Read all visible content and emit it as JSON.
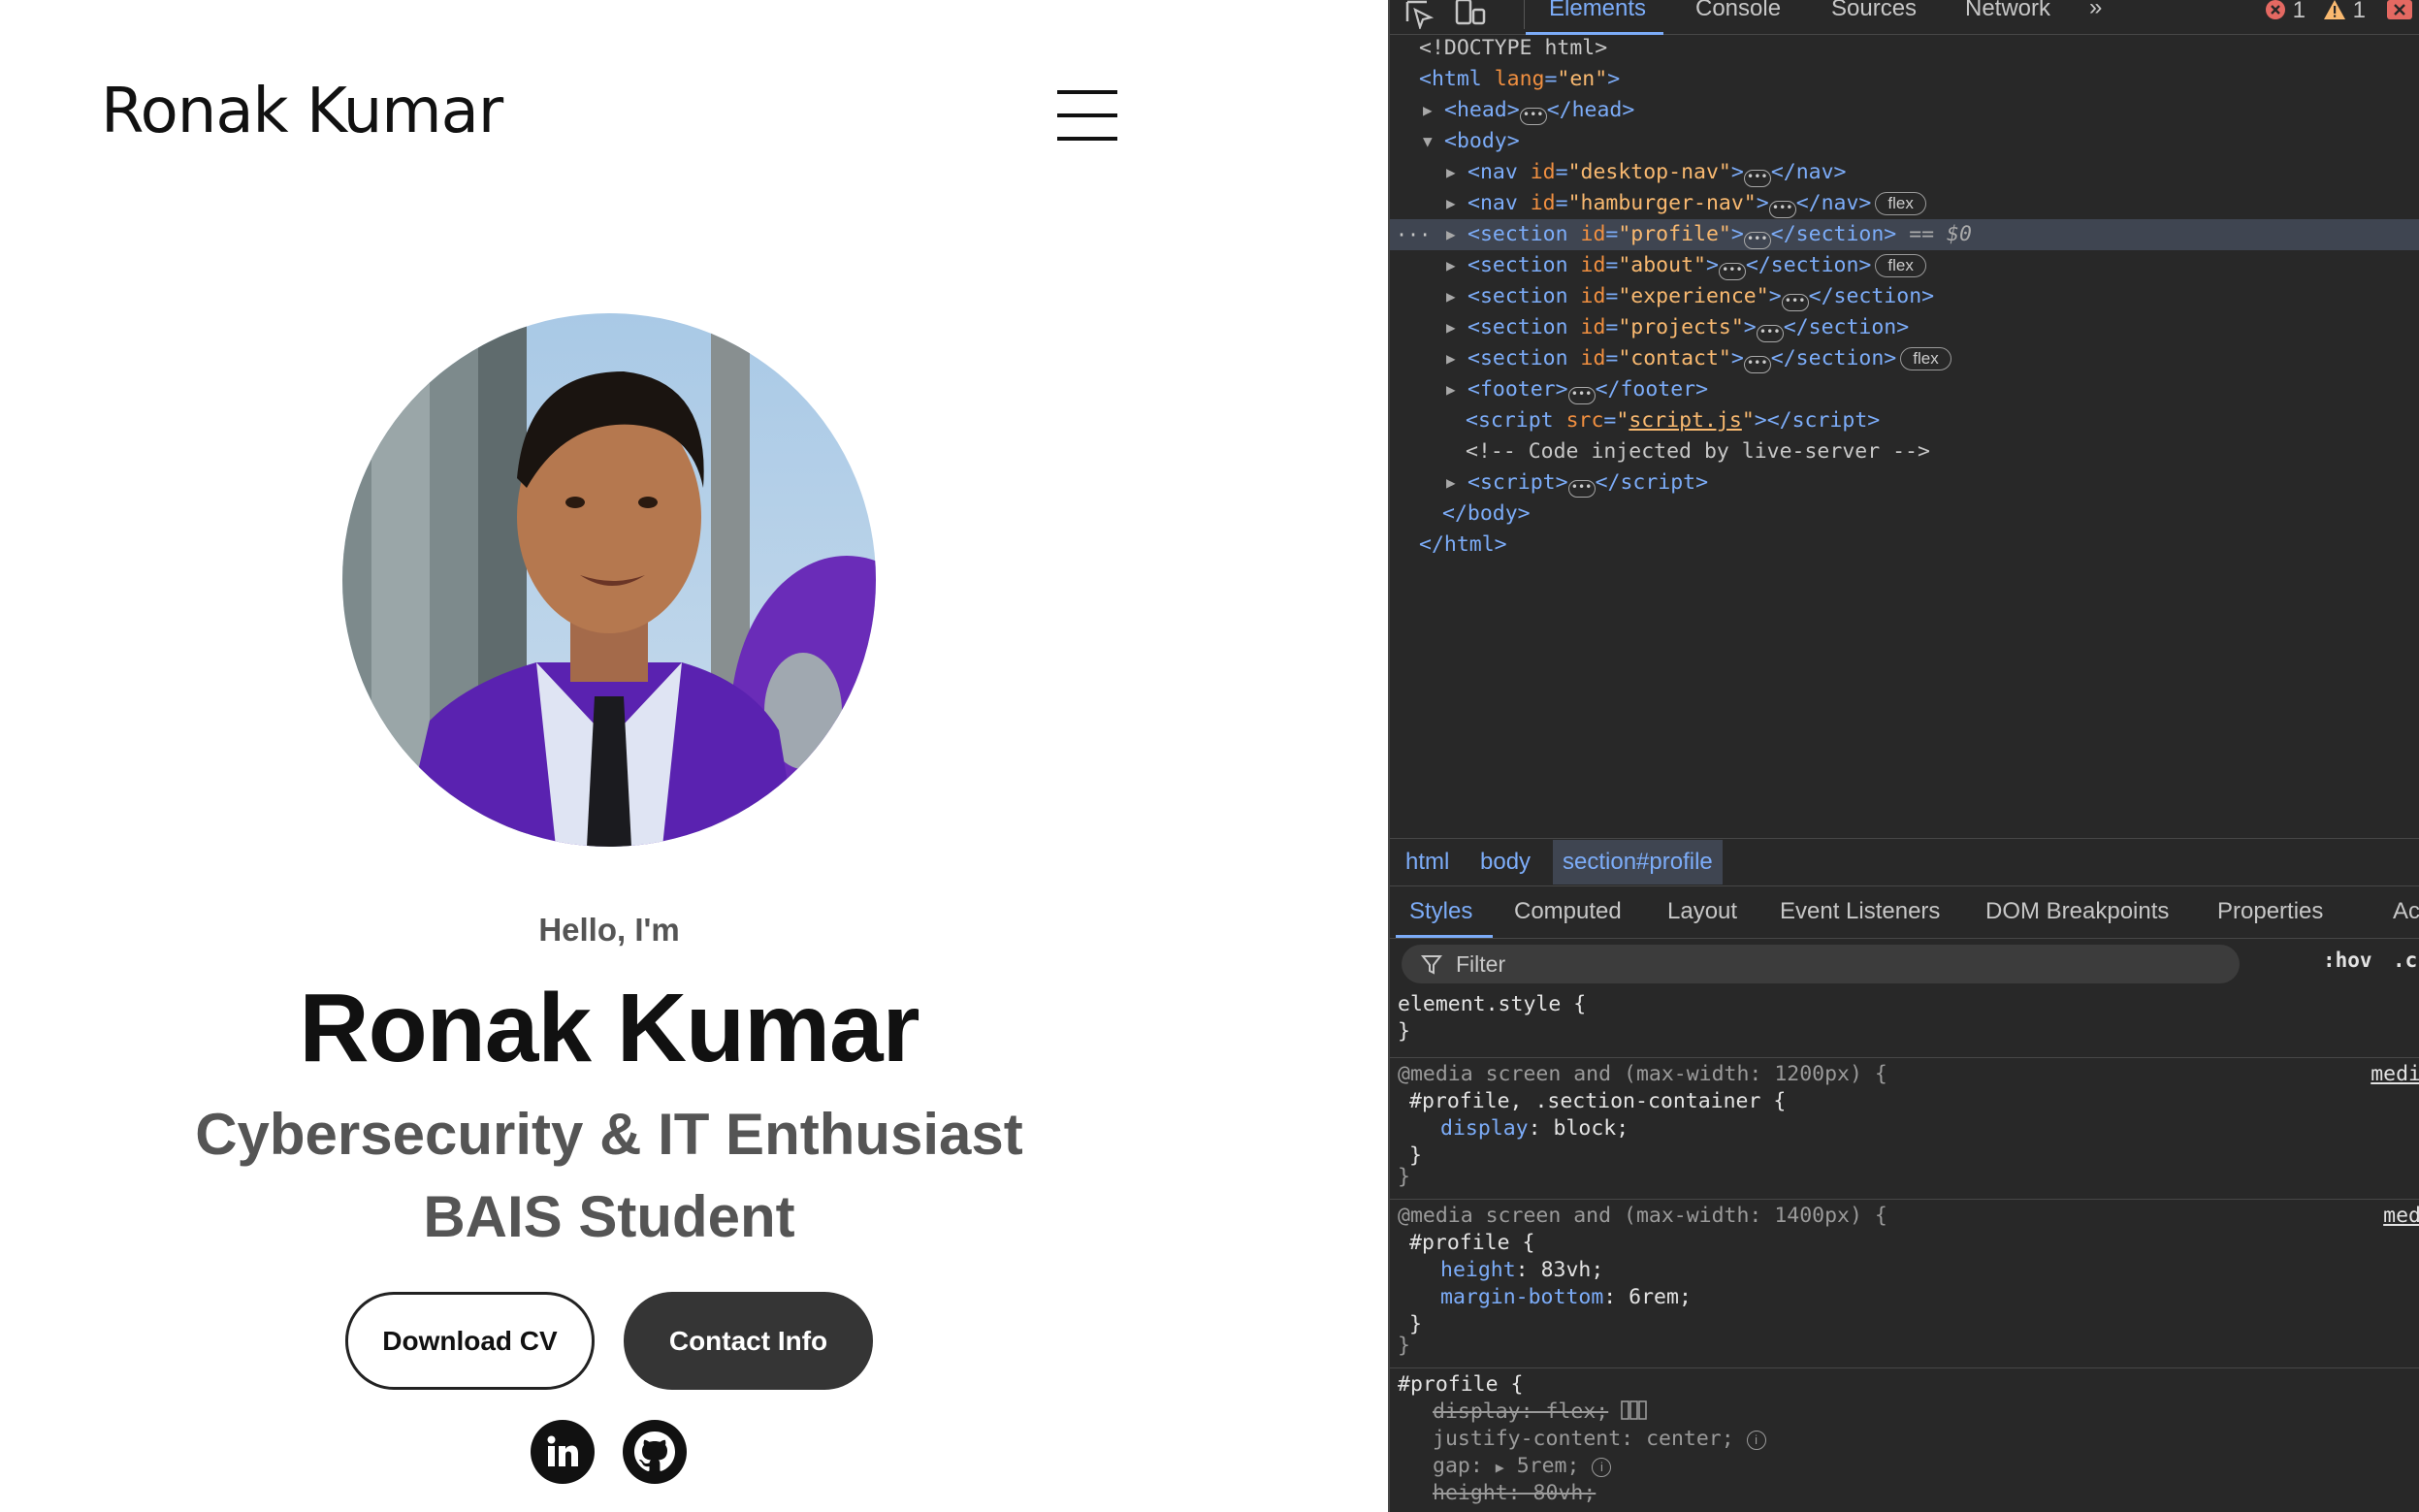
{
  "site": {
    "logo": "Ronak Kumar",
    "hello": "Hello, I'm",
    "name": "Ronak Kumar",
    "subtitle_1": "Cybersecurity & IT Enthusiast",
    "subtitle_2": "BAIS Student",
    "download_cv": "Download CV",
    "contact_info": "Contact Info",
    "social_icons": [
      "linkedin-icon",
      "github-icon"
    ]
  },
  "devtools": {
    "tabs": [
      "Elements",
      "Console",
      "Sources",
      "Network"
    ],
    "active_tab": "Elements",
    "more_tabs": "»",
    "error_count": "1",
    "warning_count": "1",
    "tree": {
      "doctype": "<!DOCTYPE html>",
      "html_open_tag": "<html",
      "html_lang_attr": "lang",
      "html_lang_val": "\"en\"",
      "head": "head",
      "body": "body",
      "nav1_id": "\"desktop-nav\"",
      "nav2_id": "\"hamburger-nav\"",
      "section_profile_id": "\"profile\"",
      "selected_marker": "== $0",
      "section_about_id": "\"about\"",
      "section_experience_id": "\"experience\"",
      "section_projects_id": "\"projects\"",
      "section_contact_id": "\"contact\"",
      "footer": "footer",
      "script_src": "script.js",
      "comment": "<!-- Code injected by live-server -->",
      "flex_badge": "flex"
    },
    "breadcrumbs": [
      "html",
      "body",
      "section#profile"
    ],
    "subtabs": [
      "Styles",
      "Computed",
      "Layout",
      "Event Listeners",
      "DOM Breakpoints",
      "Properties",
      "Acce"
    ],
    "filter_placeholder": "Filter",
    "hov": ":hov",
    "cls": ".c",
    "styles": {
      "element_style": "element.style {",
      "close_brace": "}",
      "media1": "@media screen and (max-width: 1200px) {",
      "media1_selector": "#profile, .section-container {",
      "media1_prop": "display",
      "media1_val": "block;",
      "media1_source": "medi",
      "media2": "@media screen and (max-width: 1400px) {",
      "media2_selector": "#profile {",
      "media2_prop1": "height",
      "media2_val1": "83vh;",
      "media2_prop2": "margin-bottom",
      "media2_val2": "6rem;",
      "media2_source": "med",
      "rule3_selector": "#profile {",
      "rule3_prop1": "display: flex;",
      "rule3_prop2": "justify-content",
      "rule3_val2": "center;",
      "rule3_prop3": "gap",
      "rule3_val3": "5rem;",
      "rule3_prop4": "height: 80vh;"
    },
    "colors": {
      "bg": "#282828",
      "tag": "#7cacf8",
      "attr": "#f08f40",
      "value": "#f9b970",
      "selected_row": "#3f4551"
    }
  }
}
